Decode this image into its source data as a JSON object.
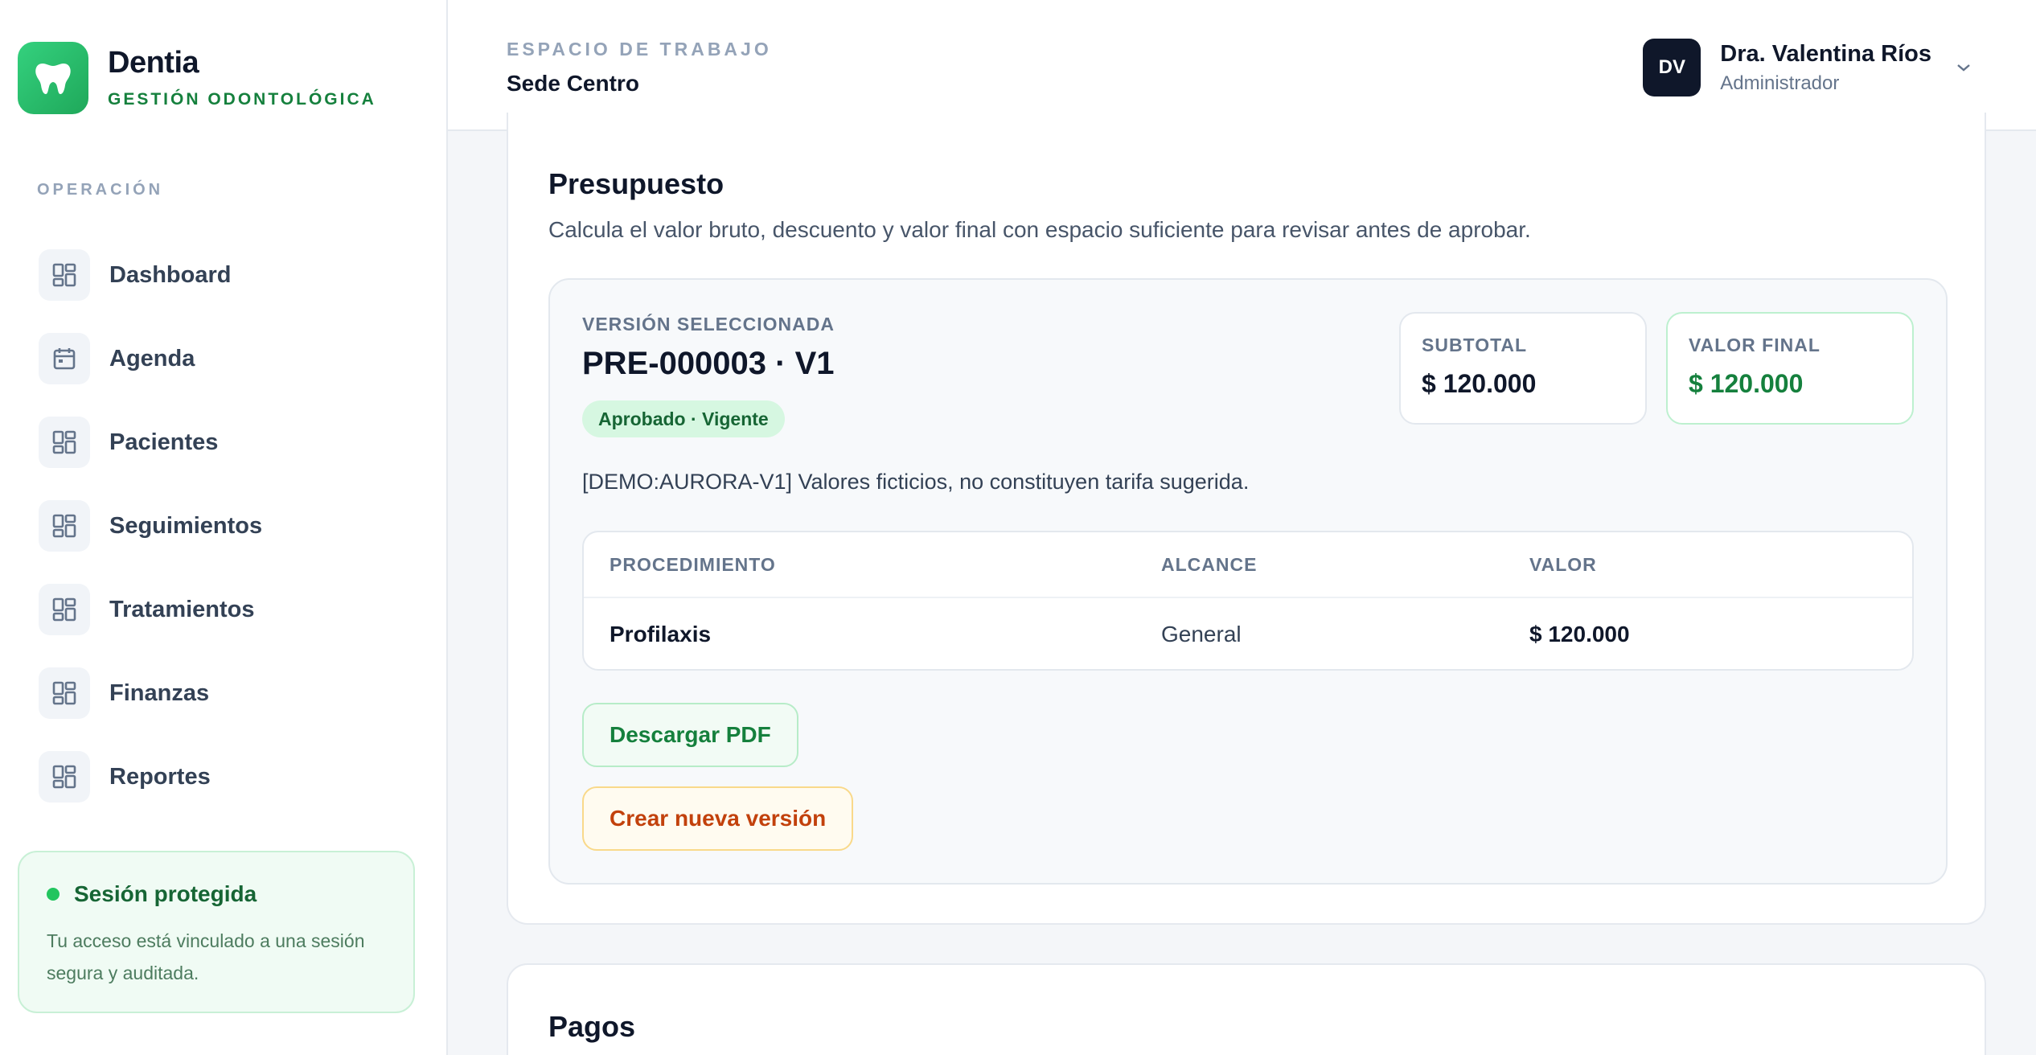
{
  "brand": {
    "name": "Dentia",
    "subtitle": "GESTIÓN ODONTOLÓGICA"
  },
  "sidebar": {
    "section_label": "OPERACIÓN",
    "items": [
      {
        "label": "Dashboard",
        "icon": "dashboard-icon"
      },
      {
        "label": "Agenda",
        "icon": "calendar-icon"
      },
      {
        "label": "Pacientes",
        "icon": "dashboard-icon"
      },
      {
        "label": "Seguimientos",
        "icon": "dashboard-icon"
      },
      {
        "label": "Tratamientos",
        "icon": "dashboard-icon"
      },
      {
        "label": "Finanzas",
        "icon": "dashboard-icon"
      },
      {
        "label": "Reportes",
        "icon": "dashboard-icon"
      }
    ],
    "session": {
      "title": "Sesión protegida",
      "text": "Tu acceso está vinculado a una sesión segura y auditada."
    }
  },
  "header": {
    "workspace_label": "ESPACIO DE TRABAJO",
    "workspace_name": "Sede Centro",
    "user": {
      "initials": "DV",
      "name": "Dra. Valentina Ríos",
      "role": "Administrador"
    }
  },
  "budget": {
    "title": "Presupuesto",
    "description": "Calcula el valor bruto, descuento y valor final con espacio suficiente para revisar antes de aprobar.",
    "version_label": "VERSIÓN SELECCIONADA",
    "version_id": "PRE-000003 · V1",
    "status_badge": "Aprobado · Vigente",
    "subtotal_label": "SUBTOTAL",
    "subtotal_value": "$ 120.000",
    "final_label": "VALOR FINAL",
    "final_value": "$ 120.000",
    "note": "[DEMO:AURORA-V1] Valores ficticios, no constituyen tarifa sugerida.",
    "table": {
      "headers": [
        "PROCEDIMIENTO",
        "ALCANCE",
        "VALOR"
      ],
      "rows": [
        {
          "procedure": "Profilaxis",
          "scope": "General",
          "value": "$ 120.000"
        }
      ]
    },
    "download_pdf_label": "Descargar PDF",
    "new_version_label": "Crear nueva versión"
  },
  "payments": {
    "title": "Pagos"
  },
  "colors": {
    "brand_green": "#22c55e",
    "dark_green": "#15803d",
    "warning_orange": "#c2410c",
    "avatar_dark": "#0f172a"
  }
}
